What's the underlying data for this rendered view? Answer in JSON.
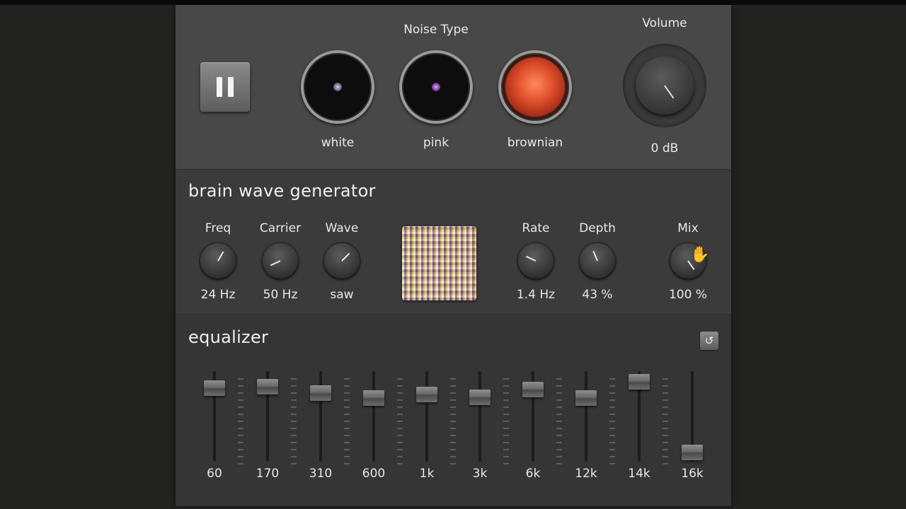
{
  "noise": {
    "heading": "Noise Type",
    "types": [
      {
        "label": "white"
      },
      {
        "label": "pink"
      },
      {
        "label": "brownian"
      }
    ],
    "active_type": "brownian",
    "volume_label": "Volume",
    "volume_value": "0 dB"
  },
  "brain": {
    "title": "brain wave generator",
    "knobs": [
      {
        "label": "Freq",
        "value": "24 Hz"
      },
      {
        "label": "Carrier",
        "value": "50 Hz"
      },
      {
        "label": "Wave",
        "value": "saw"
      },
      {
        "label": "Rate",
        "value": "1.4 Hz"
      },
      {
        "label": "Depth",
        "value": "43 %"
      },
      {
        "label": "Mix",
        "value": "100 %"
      }
    ]
  },
  "equalizer": {
    "title": "equalizer",
    "reset_icon": "reset-icon",
    "bands": [
      {
        "label": "60",
        "level": 0.88
      },
      {
        "label": "170",
        "level": 0.9
      },
      {
        "label": "310",
        "level": 0.82
      },
      {
        "label": "600",
        "level": 0.76
      },
      {
        "label": "1k",
        "level": 0.8
      },
      {
        "label": "3k",
        "level": 0.77
      },
      {
        "label": "6k",
        "level": 0.87
      },
      {
        "label": "12k",
        "level": 0.76
      },
      {
        "label": "14k",
        "level": 0.96
      },
      {
        "label": "16k",
        "level": 0.07
      }
    ]
  },
  "colors": {
    "panel": "#363636",
    "noise_section": "#484848",
    "brownian_orb": "#e0502c"
  }
}
